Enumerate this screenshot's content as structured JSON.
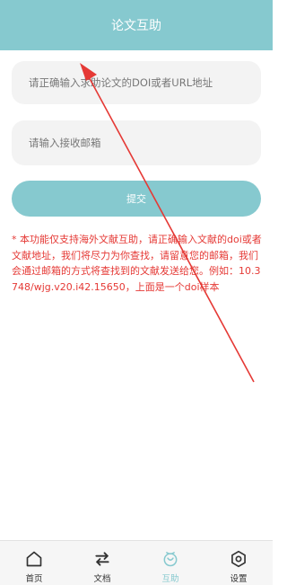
{
  "header": {
    "title": "论文互助"
  },
  "form": {
    "doi_placeholder": "请正确输入求助论文的DOI或者URL地址",
    "email_placeholder": "请输入接收邮箱",
    "submit_label": "提交"
  },
  "notice": "* 本功能仅支持海外文献互助，请正确输入文献的doi或者文献地址，我们将尽力为你查找，请留意您的邮箱，我们会通过邮箱的方式将查找到的文献发送给您。例如：10.3748/wjg.v20.i42.15650，上面是一个doi样本",
  "tabbar": {
    "items": [
      {
        "label": "首页",
        "icon": "home-icon",
        "active": false
      },
      {
        "label": "文档",
        "icon": "swap-arrows-icon",
        "active": false
      },
      {
        "label": "互助",
        "icon": "help-icon",
        "active": true
      },
      {
        "label": "设置",
        "icon": "settings-icon",
        "active": false
      }
    ]
  },
  "colors": {
    "accent": "#86c9cf",
    "notice": "#e53935",
    "annotation_arrow": "#e53935"
  }
}
